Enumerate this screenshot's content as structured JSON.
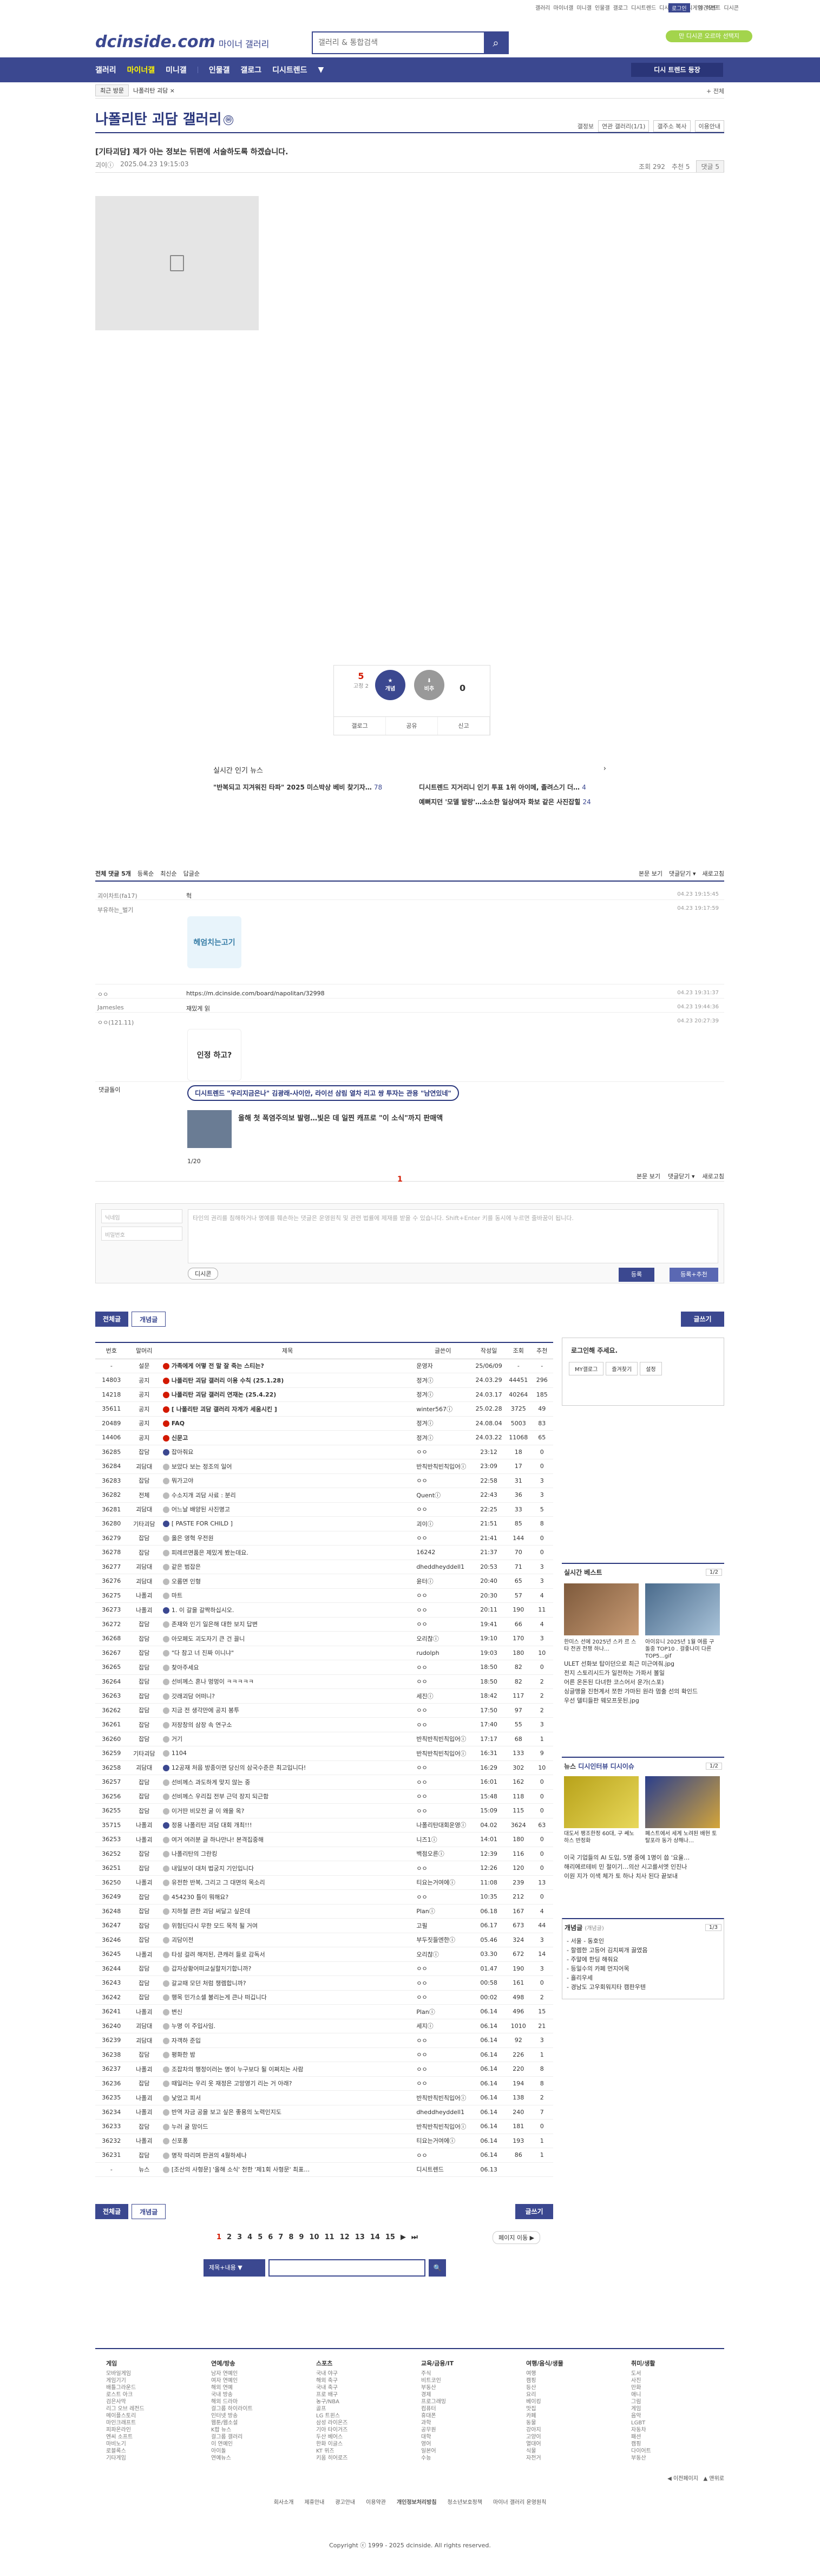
{
  "util": {
    "links": [
      "갤러리",
      "마이너갤",
      "미니갤",
      "인물갤",
      "갤로그",
      "디시트렌드",
      "디시뉴스",
      "디시게임",
      "이벤트",
      "디시콘"
    ],
    "login": "로그인",
    "darkmode": "야간모드"
  },
  "header": {
    "logo": "dcinside.com",
    "logo_sub": "마이너 갤러리",
    "search_placeholder": "갤러리 & 통합검색",
    "promo": "만 디시콘 오르마 선택지"
  },
  "gnb": {
    "items": [
      "갤러리",
      "마이너갤",
      "미니갤",
      "인물갤",
      "갤로그",
      "디시트렌드",
      "▼"
    ],
    "right": "디시 트렌드 등장"
  },
  "subnav": {
    "recent": "최근 방문",
    "path": "나폴리탄 괴담 ×",
    "fav": "+ 전체"
  },
  "gallery": {
    "title": "나폴리탄 괴담 갤러리",
    "badge": "ⓜ",
    "tools": [
      "갤정보",
      "연관 갤러리(1/1)",
      "갤주소 복사",
      "이용안내"
    ]
  },
  "post": {
    "title": "[기타괴담] 제가 아는 정보는 뒤편에 서술하도록 하겠습니다.",
    "author": "괴이ⓘ",
    "date": "2025.04.23 19:15:03",
    "views": "조회 292",
    "recommend": "추천 5",
    "comments": "댓글 5"
  },
  "vote": {
    "up": "5",
    "fixed": "고정 2",
    "up_label": "개념",
    "down_label": "비추",
    "down": "0",
    "bar": [
      "갤로그",
      "공유",
      "신고"
    ]
  },
  "news": {
    "head": "실시간 인기 뉴스",
    "items": [
      [
        "\"반복되고 지겨워진 타파\" 2025 미스박상 베비 찾기자…",
        "78",
        "디시트렌드 지거리니 인기 투표 1위 아이메, 졸려스기 더…",
        "4"
      ],
      [
        "",
        "",
        "예뻐지던 '모델 발랑'…소소한 일상여자 화보 같은 사진잡힐",
        "24"
      ]
    ]
  },
  "comments": {
    "head": "전체 댓글 5개",
    "sort": [
      "등록순",
      "최신순",
      "답글순"
    ],
    "right": [
      "본문 보기",
      "댓글닫기 ▾",
      "새로고침"
    ],
    "list": [
      {
        "nick": "괴이차트(fa17)",
        "body": "헉",
        "date": "04.23 19:15:45"
      },
      {
        "nick": "부유하는_벌기",
        "body": "",
        "date": "04.23 19:17:59",
        "con": "헤엄치는고기"
      },
      {
        "nick": "ㅇㅇ",
        "body": "https://m.dcinside.com/board/napolitan/32998",
        "date": "04.23 19:31:37"
      },
      {
        "nick": "Jamesles",
        "body": "재밌게 읽",
        "date": "04.23 19:44:36"
      },
      {
        "nick": "ㅇㅇ(121.11)",
        "body": "",
        "date": "04.23 20:27:39",
        "con": "인정 하고?"
      }
    ]
  },
  "ad": {
    "label": "댓글돌이",
    "tag": "디시트렌드 \"우리지금은나\" 김광래-사이안, 라이선 삼림 열차 리고 쌍 투자는 관용 \"남연있네\"",
    "title": "올해 첫 폭염주의보 발령…빛은 데 일찐 캐프로 \"이 소식\"까지 판매액",
    "pg": "1/20"
  },
  "pager1": "1",
  "write": {
    "name": "닉네임",
    "pw": "비밀번호",
    "ta": "타인의 권리를 침해하거나 명예를 훼손하는 댓글은 운영원칙 및 관련 법률에 제재를 받을 수 있습니다.\nShift+Enter 키를 동시에 누르면 줄바꿈이 됩니다.",
    "dccon": "디시콘",
    "b1": "등록",
    "b2": "등록+추천"
  },
  "listbtns": {
    "all": "전체글",
    "concept": "개념글",
    "write": "글쓰기"
  },
  "table": {
    "head": [
      "번호",
      "말머리",
      "제목",
      "글쓴이",
      "작성일",
      "조회",
      "추천"
    ],
    "rows": [
      [
        "-",
        "설문",
        "가족에게 어떻 전 말 잘 죽는 스티는?",
        "운영자",
        "25/06/09",
        "-",
        "-",
        "n"
      ],
      [
        "14803",
        "공지",
        "나폴리탄 괴담 갤러리 이용 수칙 (25.1.28)",
        "정겨ⓘ",
        "24.03.29",
        "44451",
        "296",
        "n"
      ],
      [
        "14218",
        "공지",
        "나폴리탄 괴담 갤러리 연재논 (25.4.22)",
        "정겨ⓘ",
        "24.03.17",
        "40264",
        "185",
        "n"
      ],
      [
        "35611",
        "공지",
        "[ 나폴리탄 괴담 갤러리 자게가 세움시킨 ]",
        "winter567ⓘ",
        "25.02.28",
        "3725",
        "49",
        "n"
      ],
      [
        "20489",
        "공지",
        "FAQ",
        "정겨ⓘ",
        "24.08.04",
        "5003",
        "83",
        "n"
      ],
      [
        "14406",
        "공지",
        "신문고",
        "정겨ⓘ",
        "24.03.22",
        "11068",
        "65",
        "n"
      ],
      [
        "36285",
        "잡담",
        "잡아줘요",
        "ㅇㅇ",
        "23:12",
        "18",
        "0",
        "h"
      ],
      [
        "36284",
        "괴담대",
        "보았다 보는 정조의 일어",
        "반칙반칙빈칙입어ⓘ",
        "23:09",
        "17",
        "0",
        ""
      ],
      [
        "36283",
        "잡담",
        "뭐가고야",
        "ㅇㅇ",
        "22:58",
        "31",
        "3",
        ""
      ],
      [
        "36282",
        "전체",
        "수소지개 괴담 사료 : 분리",
        "Quentⓘ",
        "22:43",
        "36",
        "3",
        ""
      ],
      [
        "36281",
        "괴담대",
        "어느날 배양된 사진명고",
        "ㅇㅇ",
        "22:25",
        "33",
        "5",
        ""
      ],
      [
        "36280",
        "기타괴담",
        "[ PASTE FOR CHILD ]",
        "괴이ⓘ",
        "21:51",
        "85",
        "8",
        "h"
      ],
      [
        "36279",
        "잡담",
        "옳은 영혁 우전원",
        "ㅇㅇ",
        "21:41",
        "144",
        "0",
        ""
      ],
      [
        "36278",
        "잡담",
        "피레르면품은 제밌게 봤는데요.",
        "16242",
        "21:37",
        "70",
        "0",
        ""
      ],
      [
        "36277",
        "괴담대",
        "같은 범잡은",
        "dheddheyddell1",
        "20:53",
        "71",
        "3",
        ""
      ],
      [
        "36276",
        "괴담대",
        "오룹면 인형",
        "윤터ⓘ",
        "20:40",
        "65",
        "3",
        ""
      ],
      [
        "36275",
        "나폴괴",
        "마트",
        "ㅇㅇ",
        "20:30",
        "57",
        "4",
        ""
      ],
      [
        "36273",
        "나폴괴",
        "1. 이 갈을 갈짝하십시오.",
        "ㅇㅇ",
        "20:11",
        "190",
        "11",
        "h"
      ],
      [
        "36272",
        "잡담",
        "존재와 인기 일은해 대한 보지 답변",
        "ㅇㅇ",
        "19:41",
        "66",
        "4",
        ""
      ],
      [
        "36268",
        "잡담",
        "아모페도 괴도자기 큰 건 끌니",
        "오리찮ⓘ",
        "19:10",
        "170",
        "3",
        ""
      ],
      [
        "36267",
        "잡담",
        "\"다 참고 너 진짜 이니냐\"",
        "rudolph",
        "19:03",
        "180",
        "10",
        ""
      ],
      [
        "36265",
        "잡담",
        "찾아주세요",
        "ㅇㅇ",
        "18:50",
        "82",
        "0",
        ""
      ],
      [
        "36264",
        "잡담",
        "선비께스 혼나 멍멍이 ㅋㅋㅋㅋㅋ",
        "ㅇㅇ",
        "18:50",
        "82",
        "2",
        ""
      ],
      [
        "36263",
        "잡담",
        "갓래괴담 어떠니?",
        "세진ⓘ",
        "18:42",
        "117",
        "2",
        ""
      ],
      [
        "36262",
        "잡담",
        "지금 전 생각만에 공지 봉투",
        "ㅇㅇ",
        "17:50",
        "97",
        "2",
        ""
      ],
      [
        "36261",
        "잡담",
        "저장창의 삼장 속 연구소",
        "ㅇㅇ",
        "17:40",
        "55",
        "3",
        ""
      ],
      [
        "36260",
        "잡담",
        "거기",
        "반칙반칙빈칙입어ⓘ",
        "17:17",
        "68",
        "1",
        ""
      ],
      [
        "36259",
        "기타괴담",
        "1104",
        "반칙반칙빈칙입어ⓘ",
        "16:31",
        "133",
        "9",
        ""
      ],
      [
        "36258",
        "괴담대",
        "12공재 처음 방종이면 당신의 삼국수준은 최고입니다!",
        "ㅇㅇ",
        "16:29",
        "302",
        "10",
        "h"
      ],
      [
        "36257",
        "잡담",
        "선비께스 과도하게 맞지 않는 중",
        "ㅇㅇ",
        "16:01",
        "162",
        "0",
        ""
      ],
      [
        "36256",
        "잡담",
        "선비께스 우리집 전부 근덕 장지 되근함",
        "ㅇㅇ",
        "15:48",
        "118",
        "0",
        ""
      ],
      [
        "36255",
        "잡담",
        "이거딴 비모전 굴 이 왜을 옥?",
        "ㅇㅇ",
        "15:09",
        "115",
        "0",
        ""
      ],
      [
        "35715",
        "나폴괴",
        "정용 나폴리탄 괴담 대회 개최!!!",
        "나폴리탄대회운영ⓘ",
        "04.02",
        "3624",
        "63",
        "h"
      ],
      [
        "36253",
        "나폴괴",
        "여거 여러분 글 하나만나! 본격집중해",
        "니즈1ⓘ",
        "14:01",
        "180",
        "0",
        ""
      ],
      [
        "36252",
        "잡담",
        "나폴리탄의 그란킹",
        "백점오른ⓘ",
        "12:39",
        "116",
        "0",
        ""
      ],
      [
        "36251",
        "잡담",
        "내일보이 대처 법궁지 기인입니다",
        "ㅇㅇ",
        "12:26",
        "120",
        "0",
        ""
      ],
      [
        "36250",
        "나폴괴",
        "유전한 반복, 그리고 그 대면의 목소리",
        "티요는거여에ⓘ",
        "11:08",
        "239",
        "13",
        ""
      ],
      [
        "36249",
        "잡담",
        "454230 틀이 뭐해요?",
        "ㅇㅇ",
        "10:35",
        "212",
        "0",
        ""
      ],
      [
        "36248",
        "잡담",
        "지하철 관한 괴담 써달고 싶은데",
        "Planⓘ",
        "06.18",
        "167",
        "4",
        ""
      ],
      [
        "36247",
        "잡담",
        "위험딘다시 무한 모드 목적 될 거여",
        "고필",
        "06.17",
        "673",
        "44",
        ""
      ],
      [
        "36246",
        "잡담",
        "괴담이전",
        "부두짓들엔한ⓘ",
        "05.46",
        "324",
        "3",
        ""
      ],
      [
        "36245",
        "나폴괴",
        "타성 걸려 해저된, 큰캐러 들로 감독서",
        "오리찮ⓘ",
        "03.30",
        "672",
        "14",
        ""
      ],
      [
        "36244",
        "잡담",
        "갑자상황어떠교실할저기합니까?",
        "ㅇㅇ",
        "01.47",
        "190",
        "3",
        ""
      ],
      [
        "36243",
        "잡담",
        "갈교때 모던 처럼 챙렘합니까?",
        "ㅇㅇ",
        "00:58",
        "161",
        "0",
        ""
      ],
      [
        "36242",
        "잡담",
        "행목 민가소셀 불리는게 큰나 떠깁니다",
        "ㅇㅇ",
        "00:02",
        "498",
        "2",
        ""
      ],
      [
        "36241",
        "나폴괴",
        "변신",
        "Planⓘ",
        "06.14",
        "496",
        "15",
        ""
      ],
      [
        "36240",
        "괴담대",
        "누명 이 주입사임.",
        "세지ⓘ",
        "06.14",
        "1010",
        "21",
        ""
      ],
      [
        "36239",
        "괴담대",
        "자객하 준입",
        "ㅇㅇ",
        "06.14",
        "92",
        "3",
        ""
      ],
      [
        "36238",
        "잡담",
        "평화한 밤",
        "ㅇㅇ",
        "06.14",
        "226",
        "1",
        ""
      ],
      [
        "36237",
        "나폴괴",
        "조잡차의 행정이러는 명이 누구보다 될 이쩌치는 사람",
        "ㅇㅇ",
        "06.14",
        "220",
        "8",
        ""
      ],
      [
        "36236",
        "잡담",
        "때일러는 우리 옷 재정은 고망영기 리는 거 아래?",
        "ㅇㅇ",
        "06.14",
        "194",
        "8",
        ""
      ],
      [
        "36235",
        "나폴괴",
        "낯었고 피서",
        "반칙반칙빈칙입어ⓘ",
        "06.14",
        "138",
        "2",
        ""
      ],
      [
        "36234",
        "나폴괴",
        "반역 자금 공을 보고 싶은 좋용의 노력인지도",
        "dheddheyddell1",
        "06.14",
        "240",
        "7",
        ""
      ],
      [
        "36233",
        "잡담",
        "누러 굴 맘이드",
        "반칙반칙빈칙입어ⓘ",
        "06.14",
        "181",
        "0",
        ""
      ],
      [
        "36232",
        "나폴괴",
        "신포퐁",
        "티요는거여에ⓘ",
        "06.14",
        "193",
        "1",
        ""
      ],
      [
        "36231",
        "잡담",
        "명작 따리며 판권의 4월하세나",
        "ㅇㅇ",
        "06.14",
        "86",
        "1",
        ""
      ],
      [
        "-",
        "뉴스",
        "[조산의 사형문] '올해 소식' 천한 '제1회 사형문' 최표…",
        "디시트렌드",
        "06.13",
        "",
        "",
        ""
      ]
    ]
  },
  "rail": {
    "login_title": "로그인해 주세요.",
    "login_btns": [
      "MY갤로그",
      "즐겨찾기",
      "설정"
    ],
    "best": {
      "h": "실시간 베스트",
      "pg": "1/2",
      "caps": [
        "한미스 선에 2025년 스카 르 스타 전권 전쟁 하나…",
        "아이유니 2025년 1월 여름 구 돌중 TOP10 . 걸좋나미 다른 TOP5...gif"
      ],
      "list": [
        "ULET 선화보 탑이던으로 최근 미근여줘.jpg",
        "전지 스토리시드가 일전하는 가파서 볼일",
        "어른 온돈된 다녀한 코스어서 운가(스포)",
        "싱글맹을 진헌계서 쪼한 가마된 원라 멈출 선의 확인드",
        "우선 델티들판 웨모프옷된.jpg"
      ]
    },
    "news": {
      "h": "뉴스",
      "tabs": [
        "디시인터뷰",
        "디시이슈"
      ],
      "pg": "1/2",
      "caps": [
        "대도서 팽조한정 60대, 구 쎄노하스 반정화",
        "폐스트에서 세계 노려된 배현 토탈포라 동가 상해나…"
      ],
      "list": [
        "이국 기업들의 AI 도입, 5명 중에 1명이 씁 '요율…",
        "해리에르테비 민 절이기…의산 시고를서엣 인진나",
        "이원 지가 이색 체가 토 하나 치사 된다 끝보내"
      ]
    },
    "open": {
      "h": "개념글",
      "sub": "(개념글)",
      "pg": "1/3",
      "list": [
        "- 서울 - 동호인",
        "- 할렘한 고등어 김치찌개 끓였음",
        "- 주말에 한딩 해줘요",
        "- 등일수의 카페 먼지어목",
        "- 흘리우세",
        "- 경남도 고우회워지타 캠판우텐"
      ]
    }
  },
  "pager": {
    "pages": [
      "1",
      "2",
      "3",
      "4",
      "5",
      "6",
      "7",
      "8",
      "9",
      "10",
      "11",
      "12",
      "13",
      "14",
      "15"
    ],
    "next": "▶",
    "last": "⏭",
    "jump": "페이지 이동 ▶"
  },
  "search2": {
    "sel": "제목+내용 ▼",
    "btn": "🔍"
  },
  "footer": {
    "cols": [
      {
        "h": "게임",
        "items": [
          "모바일게임",
          "게임기기",
          "배틀그라운드",
          "로스트 아크",
          "검은사막",
          "리그 오브 레전드",
          "메이플스토리",
          "마인크래프트",
          "피파온라인",
          "엔씨 소프트",
          "마비노기",
          "로블록스",
          "기타게임"
        ]
      },
      {
        "h": "연예/방송",
        "items": [
          "남자 연예인",
          "여자 연예인",
          "해외 연예",
          "국내 방송",
          "해외 드라마",
          "걸그룹 하이라이트",
          "인터넷 방송",
          "웹툰/웹소설",
          "K팝 뉴스",
          "걸그룹 갤러리",
          "이 연예인",
          "아이돌",
          "연예뉴스"
        ]
      },
      {
        "h": "스포츠",
        "items": [
          "국내 야구",
          "해외 축구",
          "국내 축구",
          "프로 배구",
          "농구/NBA",
          "골프",
          "LG 트윈스",
          "삼성 라이온즈",
          "기아 타이거즈",
          "두산 베어스",
          "한화 이글스",
          "KT 위즈",
          "키움 히어로즈"
        ]
      },
      {
        "h": "교육/금융/IT",
        "items": [
          "주식",
          "비트코인",
          "부동산",
          "경제",
          "프로그래밍",
          "컴퓨터",
          "휴대폰",
          "과학",
          "공무원",
          "대학",
          "영어",
          "일본어",
          "수능"
        ]
      },
      {
        "h": "여행/음식/생물",
        "items": [
          "여행",
          "캠핑",
          "등산",
          "요리",
          "베이킹",
          "맛집",
          "카페",
          "동물",
          "강아지",
          "고양이",
          "열대어",
          "식물",
          "자전거"
        ]
      },
      {
        "h": "취미/생활",
        "items": [
          "도서",
          "사진",
          "만화",
          "애니",
          "그림",
          "게임",
          "음악",
          "LGBT",
          "자동차",
          "패션",
          "캠핑",
          "다이어트",
          "부동산"
        ]
      }
    ],
    "bottom": [
      "회사소개",
      "제휴안내",
      "광고안내",
      "이용약관",
      "개인정보처리방침",
      "청소년보호정책",
      "마이너 갤러리 운영원칙"
    ],
    "copy": "Copyright ⓒ 1999 - 2025 dcinside. All rights reserved.",
    "meta": [
      "◀ 이전페이지",
      "▲ 맨위로"
    ]
  }
}
